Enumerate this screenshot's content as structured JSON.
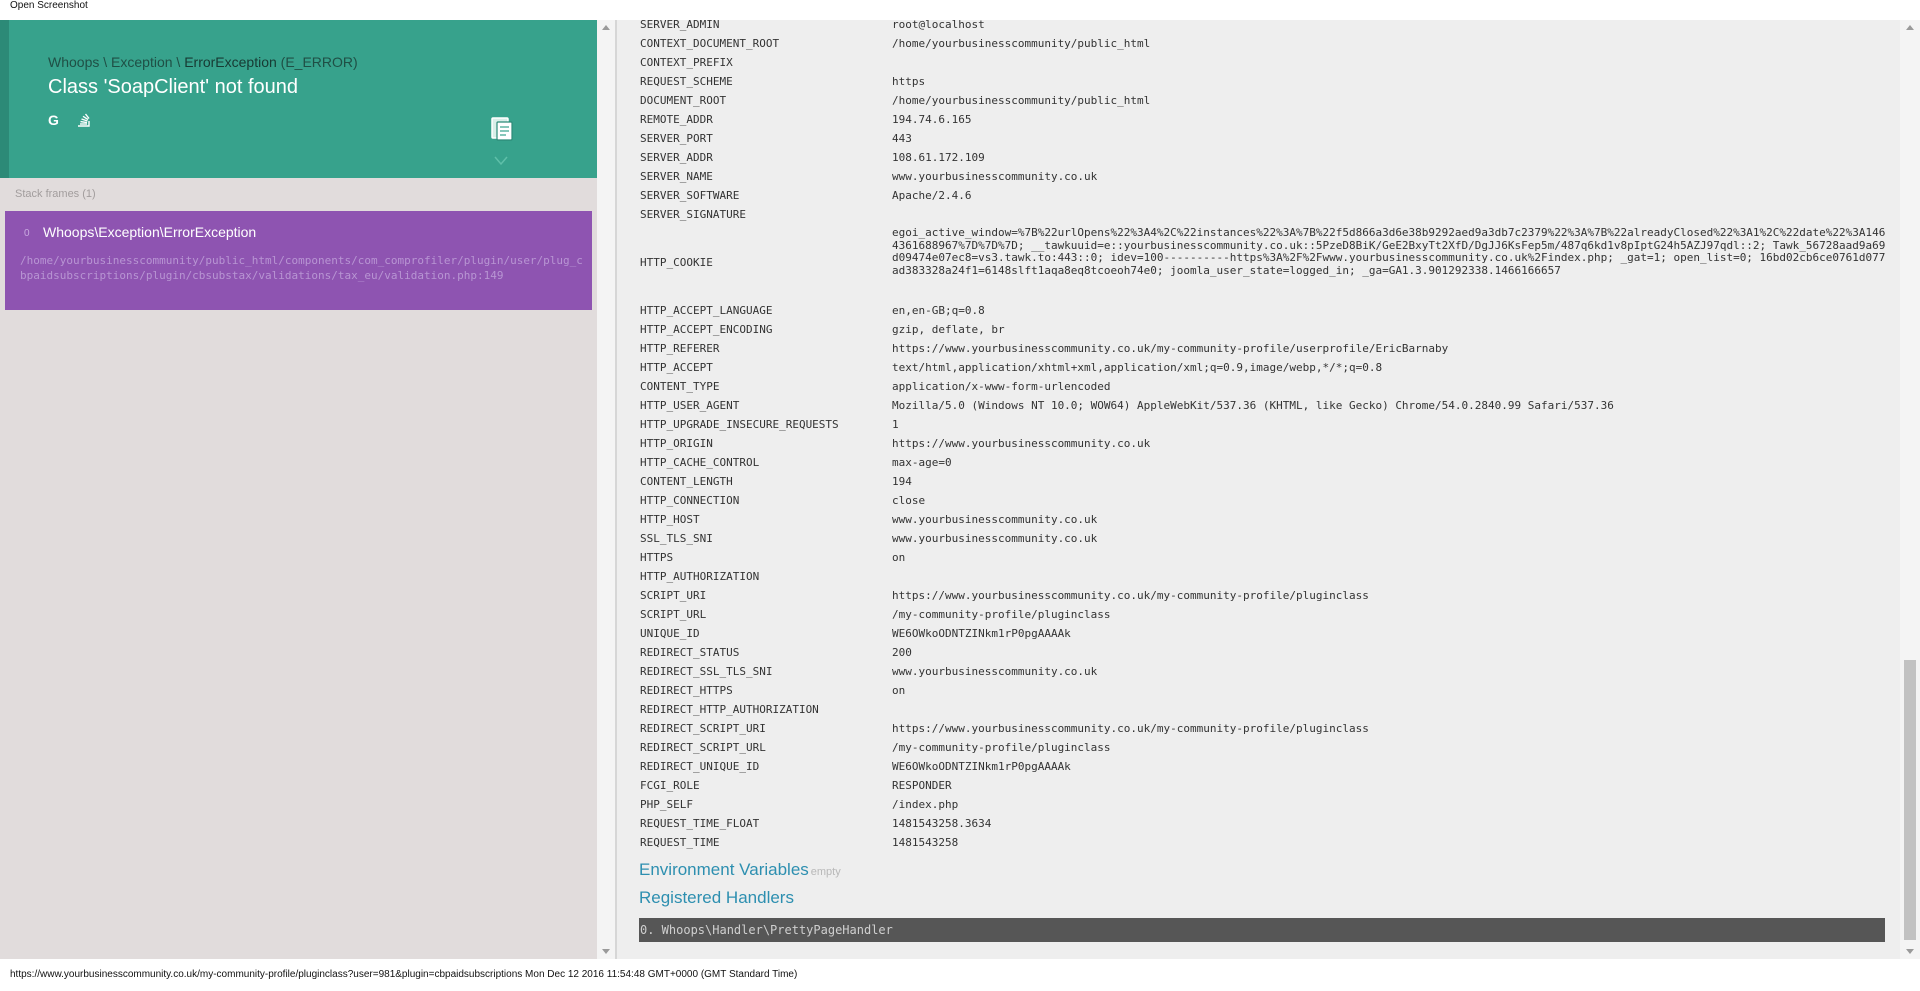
{
  "window": {
    "title": "Open Screenshot"
  },
  "error": {
    "path_prefix": "Whoops \\ Exception \\ ",
    "class_name": "ErrorException",
    "level": "(E_ERROR)",
    "message": "Class 'SoapClient' not found"
  },
  "stack": {
    "label": "Stack frames (1)",
    "frames": [
      {
        "index": "0",
        "class": "Whoops\\Exception\\ErrorException",
        "file": "/home/yourbusinesscommunity/public_html/components/com_comprofiler/plugin/user/plug_cbpaidsubscriptions/plugin/cbsubstax/validations/tax_eu/validation.php:149"
      }
    ]
  },
  "server_vars": [
    {
      "k": "SERVER_ADMIN",
      "v": "root@localhost"
    },
    {
      "k": "CONTEXT_DOCUMENT_ROOT",
      "v": "/home/yourbusinesscommunity/public_html"
    },
    {
      "k": "CONTEXT_PREFIX",
      "v": ""
    },
    {
      "k": "REQUEST_SCHEME",
      "v": "https"
    },
    {
      "k": "DOCUMENT_ROOT",
      "v": "/home/yourbusinesscommunity/public_html"
    },
    {
      "k": "REMOTE_ADDR",
      "v": "194.74.6.165"
    },
    {
      "k": "SERVER_PORT",
      "v": "443"
    },
    {
      "k": "SERVER_ADDR",
      "v": "108.61.172.109"
    },
    {
      "k": "SERVER_NAME",
      "v": "www.yourbusinesscommunity.co.uk"
    },
    {
      "k": "SERVER_SOFTWARE",
      "v": "Apache/2.4.6"
    },
    {
      "k": "SERVER_SIGNATURE",
      "v": ""
    },
    {
      "k": "HTTP_COOKIE",
      "v": "egoi_active_window=%7B%22urlOpens%22%3A4%2C%22instances%22%3A%7B%22f5d866a3d6e38b9292aed9a3db7c2379%22%3A%7B%22alreadyClosed%22%3A1%2C%22date%22%3A1464361688967%7D%7D%7D; __tawkuuid=e::yourbusinesscommunity.co.uk::5PzeD8BiK/GeE2BxyTt2XfD/DgJJ6KsFep5m/487q6kd1v8pIptG24h5AZJ97qdl::2; Tawk_56728aad9a69d09474e07ec8=vs3.tawk.to:443::0; idev=100----------https%3A%2F%2Fwww.yourbusinesscommunity.co.uk%2Findex.php; _gat=1; open_list=0; 16bd02cb6ce0761d077ad383328a24f1=6148slft1aqa8eq8tcoeoh74e0; joomla_user_state=logged_in; _ga=GA1.3.901292338.1466166657",
      "tall": true
    },
    {
      "k": "HTTP_ACCEPT_LANGUAGE",
      "v": "en,en-GB;q=0.8"
    },
    {
      "k": "HTTP_ACCEPT_ENCODING",
      "v": "gzip, deflate, br"
    },
    {
      "k": "HTTP_REFERER",
      "v": "https://www.yourbusinesscommunity.co.uk/my-community-profile/userprofile/EricBarnaby"
    },
    {
      "k": "HTTP_ACCEPT",
      "v": "text/html,application/xhtml+xml,application/xml;q=0.9,image/webp,*/*;q=0.8"
    },
    {
      "k": "CONTENT_TYPE",
      "v": "application/x-www-form-urlencoded"
    },
    {
      "k": "HTTP_USER_AGENT",
      "v": "Mozilla/5.0 (Windows NT 10.0; WOW64) AppleWebKit/537.36 (KHTML, like Gecko) Chrome/54.0.2840.99 Safari/537.36"
    },
    {
      "k": "HTTP_UPGRADE_INSECURE_REQUESTS",
      "v": "1"
    },
    {
      "k": "HTTP_ORIGIN",
      "v": "https://www.yourbusinesscommunity.co.uk"
    },
    {
      "k": "HTTP_CACHE_CONTROL",
      "v": "max-age=0"
    },
    {
      "k": "CONTENT_LENGTH",
      "v": "194"
    },
    {
      "k": "HTTP_CONNECTION",
      "v": "close"
    },
    {
      "k": "HTTP_HOST",
      "v": "www.yourbusinesscommunity.co.uk"
    },
    {
      "k": "SSL_TLS_SNI",
      "v": "www.yourbusinesscommunity.co.uk"
    },
    {
      "k": "HTTPS",
      "v": "on"
    },
    {
      "k": "HTTP_AUTHORIZATION",
      "v": ""
    },
    {
      "k": "SCRIPT_URI",
      "v": "https://www.yourbusinesscommunity.co.uk/my-community-profile/pluginclass"
    },
    {
      "k": "SCRIPT_URL",
      "v": "/my-community-profile/pluginclass"
    },
    {
      "k": "UNIQUE_ID",
      "v": "WE6OWkoODNTZINkm1rP0pgAAAAk"
    },
    {
      "k": "REDIRECT_STATUS",
      "v": "200"
    },
    {
      "k": "REDIRECT_SSL_TLS_SNI",
      "v": "www.yourbusinesscommunity.co.uk"
    },
    {
      "k": "REDIRECT_HTTPS",
      "v": "on"
    },
    {
      "k": "REDIRECT_HTTP_AUTHORIZATION",
      "v": ""
    },
    {
      "k": "REDIRECT_SCRIPT_URI",
      "v": "https://www.yourbusinesscommunity.co.uk/my-community-profile/pluginclass"
    },
    {
      "k": "REDIRECT_SCRIPT_URL",
      "v": "/my-community-profile/pluginclass"
    },
    {
      "k": "REDIRECT_UNIQUE_ID",
      "v": "WE6OWkoODNTZINkm1rP0pgAAAAk"
    },
    {
      "k": "FCGI_ROLE",
      "v": "RESPONDER"
    },
    {
      "k": "PHP_SELF",
      "v": "/index.php"
    },
    {
      "k": "REQUEST_TIME_FLOAT",
      "v": "1481543258.3634"
    },
    {
      "k": "REQUEST_TIME",
      "v": "1481543258"
    }
  ],
  "sections": {
    "env_title": "Environment Variables",
    "env_empty": "empty",
    "handlers_title": "Registered Handlers",
    "handler_item": "0. Whoops\\Handler\\PrettyPageHandler"
  },
  "status_bar": {
    "text": "https://www.yourbusinesscommunity.co.uk/my-community-profile/pluginclass?user=981&plugin=cbpaidsubscriptions Mon Dec 12 2016 11:54:48 GMT+0000 (GMT Standard Time)"
  },
  "icons": {
    "google": "google-search-icon",
    "stackoverflow": "stackoverflow-search-icon",
    "copy": "clipboard-copy-icon"
  },
  "colors": {
    "header_bg": "#37a28c",
    "frame_bg": "#8e54b1",
    "section_title": "#2d8fb0",
    "handler_bg": "#565656"
  }
}
